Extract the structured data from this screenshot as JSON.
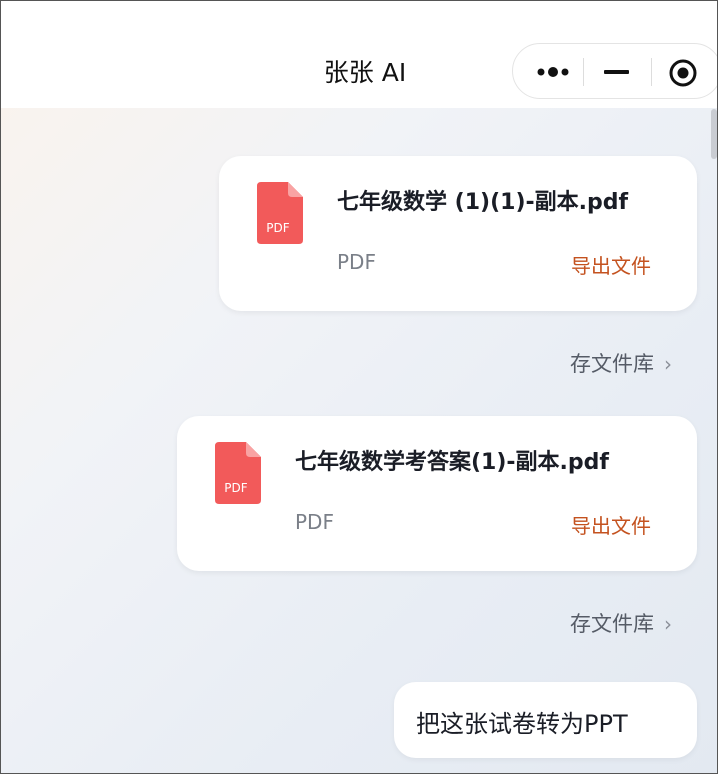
{
  "header": {
    "title": "张张 AI",
    "more_icon": "more-dots-icon",
    "minimize_icon": "minus-icon",
    "close_icon": "target-circle-icon"
  },
  "files": [
    {
      "icon": "pdf-file-icon",
      "icon_label": "PDF",
      "name": "七年级数学 (1)(1)-副本.pdf",
      "type": "PDF",
      "export_label": "导出文件",
      "save_label": "存文件库"
    },
    {
      "icon": "pdf-file-icon",
      "icon_label": "PDF",
      "name": "七年级数学考答案(1)-副本.pdf",
      "type": "PDF",
      "export_label": "导出文件",
      "save_label": "存文件库"
    }
  ],
  "user_message": {
    "text": "把这张试卷转为PPT"
  },
  "colors": {
    "pdf_red": "#f25a5a",
    "export_orange": "#c4521f"
  }
}
